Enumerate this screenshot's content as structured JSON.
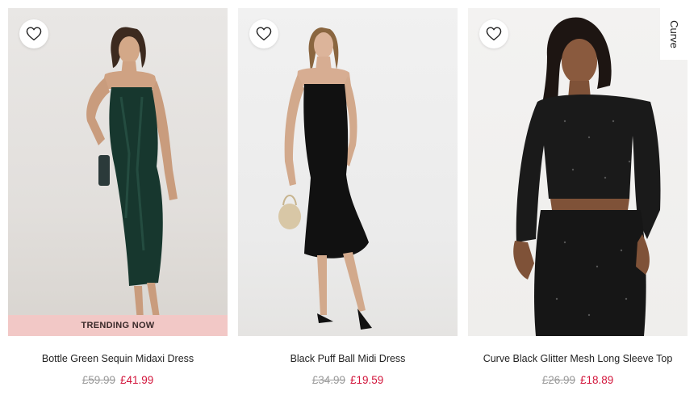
{
  "products": [
    {
      "name": "Bottle Green Sequin Midaxi Dress",
      "was_price": "£59.99",
      "now_price": "£41.99",
      "badge": "TRENDING NOW",
      "wishlist_icon": "heart-outline-icon"
    },
    {
      "name": "Black Puff Ball Midi Dress",
      "was_price": "£34.99",
      "now_price": "£19.59",
      "wishlist_icon": "heart-outline-icon"
    },
    {
      "name": "Curve Black Glitter Mesh Long Sleeve Top",
      "was_price": "£26.99",
      "now_price": "£18.89",
      "tag": "Curve",
      "wishlist_icon": "heart-outline-icon"
    }
  ],
  "colors": {
    "sale_price": "#d2143a",
    "was_price": "#9a9a9a",
    "trending_badge_bg": "#f2c8c6"
  }
}
